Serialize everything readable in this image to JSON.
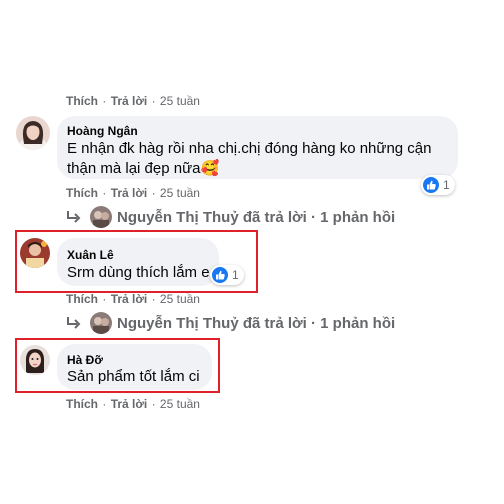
{
  "action_labels": {
    "like": "Thích",
    "reply": "Trả lời",
    "dot": "·"
  },
  "comments": [
    {
      "time": "25 tuần"
    },
    {
      "author": "Hoàng Ngân",
      "text_line1": "E nhận đk hàg rồi nha chị.chị đóng hàng ko những cận",
      "text_line2": "thận mà lại đẹp nữa🥰",
      "reaction_count": "1",
      "time": "25 tuần",
      "reply_summary": "Nguyễn Thị Thuỷ đã trả lời · 1 phản hồi"
    },
    {
      "author": "Xuân Lê",
      "text": "Srm dùng thích lắm e",
      "reaction_count": "1",
      "time": "25 tuần",
      "reply_summary": "Nguyễn Thị Thuỷ đã trả lời · 1 phản hồi"
    },
    {
      "author": "Hà Đỡ",
      "text": "Sản phẩm tốt lắm ci",
      "time": "25 tuần"
    }
  ],
  "colors": {
    "accent": "#1877f2",
    "highlight": "#e0202a",
    "bubble": "#f0f2f5",
    "muted": "#65676b"
  }
}
